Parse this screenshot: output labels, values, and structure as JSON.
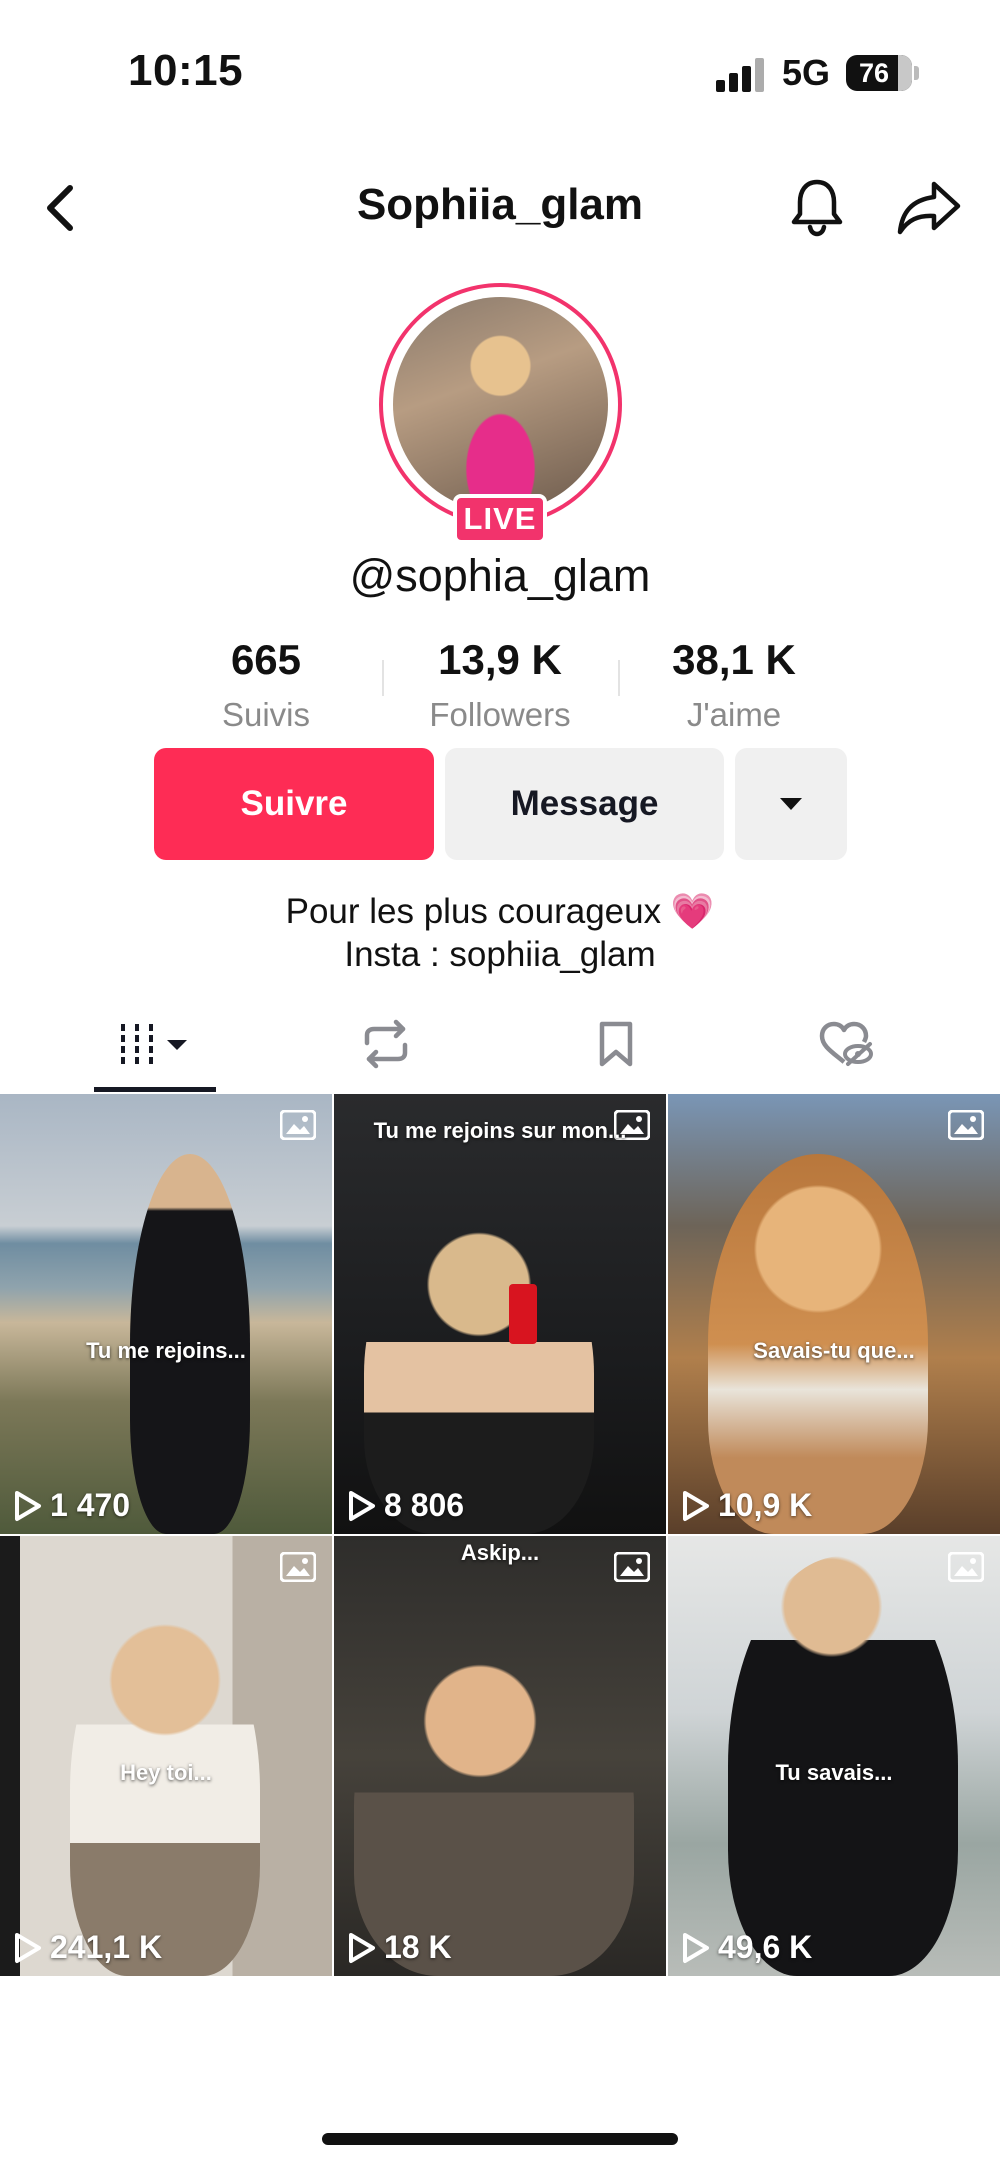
{
  "status_bar": {
    "time": "10:15",
    "network": "5G",
    "battery": "76"
  },
  "header": {
    "title": "Sophiia_glam"
  },
  "profile": {
    "live_label": "LIVE",
    "handle": "@sophia_glam",
    "stats": [
      {
        "value": "665",
        "label": "Suivis"
      },
      {
        "value": "13,9 K",
        "label": "Followers"
      },
      {
        "value": "38,1 K",
        "label": "J'aime"
      }
    ],
    "follow_label": "Suivre",
    "message_label": "Message",
    "bio_lines": [
      "Pour les plus courageux 💗",
      "Insta : sophiia_glam"
    ]
  },
  "tabs": [
    {
      "icon": "grid-icon"
    },
    {
      "icon": "repost-icon"
    },
    {
      "icon": "bookmark-icon"
    },
    {
      "icon": "liked-hidden-icon"
    }
  ],
  "videos": [
    {
      "caption": "Tu me rejoins...",
      "views": "1 470"
    },
    {
      "caption": "Tu me rejoins sur mon...",
      "views": "8 806"
    },
    {
      "caption": "Savais-tu que...",
      "views": "10,9 K"
    },
    {
      "caption": "Hey toi...",
      "views": "241,1 K"
    },
    {
      "caption": "Askip...",
      "views": "18 K"
    },
    {
      "caption": "Tu savais...",
      "views": "49,6 K"
    }
  ],
  "colors": {
    "accent": "#fe2c55",
    "live_ring": "#f2336c"
  }
}
